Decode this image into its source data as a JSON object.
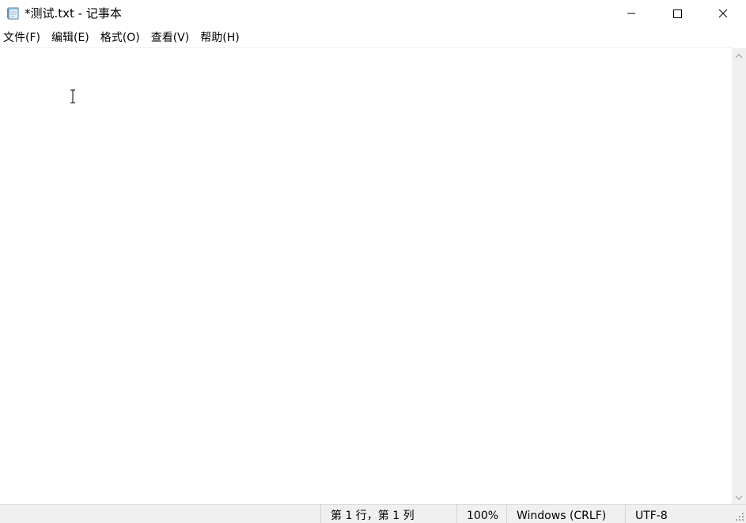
{
  "window": {
    "title": "*测试.txt - 记事本",
    "icon": "notepad-icon"
  },
  "title_controls": {
    "minimize_icon": "minimize-icon",
    "maximize_icon": "maximize-icon",
    "close_icon": "close-icon"
  },
  "menu": {
    "items": [
      {
        "label": "文件(F)"
      },
      {
        "label": "编辑(E)"
      },
      {
        "label": "格式(O)"
      },
      {
        "label": "查看(V)"
      },
      {
        "label": "帮助(H)"
      }
    ]
  },
  "editor": {
    "content": "",
    "cursor_icon": "i-beam-cursor-icon"
  },
  "scrollbar": {
    "up_icon": "scroll-up-arrow-icon",
    "down_icon": "scroll-down-arrow-icon"
  },
  "statusbar": {
    "position": "第 1 行，第 1 列",
    "zoom": "100%",
    "line_ending": "Windows (CRLF)",
    "encoding": "UTF-8"
  },
  "colors": {
    "background": "#ffffff",
    "statusbar_bg": "#f0f0f0",
    "scrollbar_bg": "#f0f0f0",
    "text": "#000000"
  }
}
